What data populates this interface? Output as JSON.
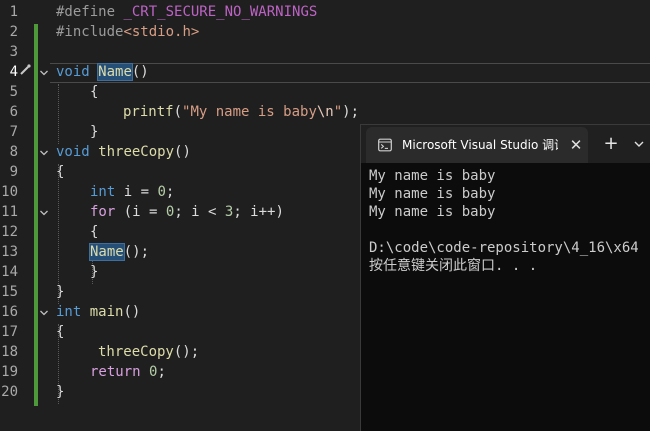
{
  "editor": {
    "line_numbers": [
      "1",
      "2",
      "3",
      "4",
      "5",
      "6",
      "7",
      "8",
      "9",
      "10",
      "11",
      "12",
      "13",
      "14",
      "15",
      "16",
      "17",
      "18",
      "19",
      "20"
    ],
    "active_line": "4",
    "l1": {
      "directive": "#define ",
      "macro": "_CRT_SECURE_NO_WARNINGS"
    },
    "l2": {
      "directive": "#include",
      "header": "<stdio.h>"
    },
    "l4": {
      "kw": "void",
      "sp": " ",
      "fn": "Name",
      "rest": "()"
    },
    "l5": {
      "text": "{"
    },
    "l6": {
      "fn": "printf",
      "open": "(",
      "str": "\"My name is baby",
      "esc": "\\n",
      "strend": "\"",
      "close": ");"
    },
    "l7": {
      "text": "}"
    },
    "l8": {
      "kw": "void",
      "sp": " ",
      "fn": "threeCopy",
      "rest": "()"
    },
    "l9": {
      "text": "{"
    },
    "l10": {
      "kw": "int",
      "rest": " i = ",
      "num": "0",
      "end": ";"
    },
    "l11": {
      "kw": "for",
      "p1": " (i = ",
      "n1": "0",
      "p2": "; i < ",
      "n2": "3",
      "p3": "; i++)"
    },
    "l12": {
      "text": "{"
    },
    "l13": {
      "fn": "Name",
      "rest": "();"
    },
    "l14": {
      "text": "}"
    },
    "l15": {
      "text": "}"
    },
    "l16": {
      "kw": "int",
      "sp": " ",
      "fn": "main",
      "rest": "()"
    },
    "l17": {
      "text": "{"
    },
    "l18": {
      "fn": "threeCopy",
      "rest": "();"
    },
    "l19": {
      "kw": "return",
      "sp": " ",
      "num": "0",
      "end": ";"
    },
    "l20": {
      "text": "}"
    }
  },
  "console": {
    "tab_title": "Microsoft Visual Studio 调试控制台",
    "tab_icon": "terminal-icon",
    "close_label": "✕",
    "new_tab_label": "+",
    "output": [
      "My name is baby",
      "My name is baby",
      "My name is baby",
      "",
      "D:\\code\\code-repository\\4_16\\x64",
      "按任意键关闭此窗口. . ."
    ]
  },
  "colors": {
    "keyword": "#569cd6",
    "function": "#dcdcaa",
    "string": "#d69d85",
    "number": "#b5cea8",
    "macro": "#bd63c5",
    "change_bar": "#4e9a3a"
  }
}
